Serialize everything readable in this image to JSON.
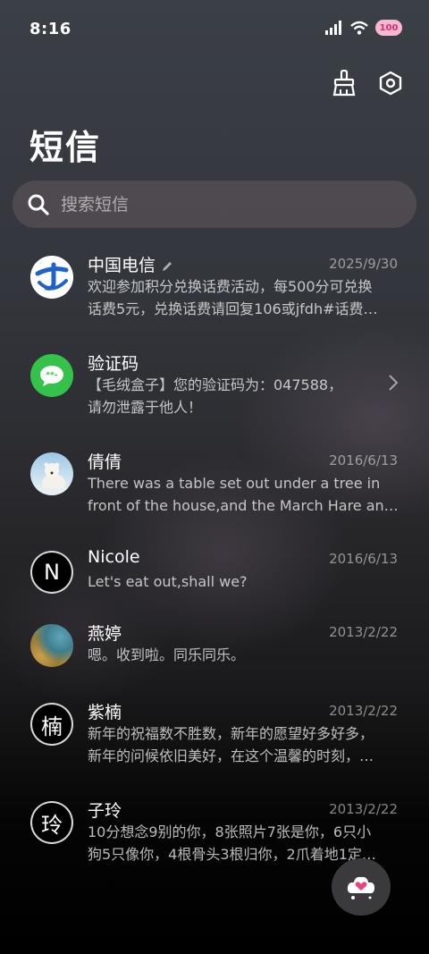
{
  "status": {
    "time": "8:16",
    "battery": "100"
  },
  "header": {
    "title": "短信"
  },
  "search": {
    "placeholder": "搜索短信"
  },
  "conversations": [
    {
      "name": "中国电信",
      "date": "2025/9/30",
      "lines": [
        "欢迎参加积分兑换话费活动，每500分可兑换",
        "话费5元，兑换话费请回复106或jfdh#话费…"
      ],
      "avatar": "china-telecom-logo"
    },
    {
      "name": "验证码",
      "date": "",
      "lines": [
        "【毛绒盒子】您的验证码为：047588，",
        "请勿泄露于他人！"
      ],
      "avatar": "message-bubble-icon"
    },
    {
      "name": "倩倩",
      "date": "2016/6/13",
      "lines": [
        "There was a table set out under a tree in",
        "front of the house,and the March Hare an…"
      ],
      "avatar": "polar-bear-photo"
    },
    {
      "name": "Nicole",
      "date": "2016/6/13",
      "lines": [
        "Let's eat out,shall we?"
      ],
      "avatar_letter": "N"
    },
    {
      "name": "燕婷",
      "date": "2013/2/22",
      "lines": [
        "嗯。收到啦。同乐同乐。"
      ],
      "avatar": "landscape-photo"
    },
    {
      "name": "紫楠",
      "date": "2013/2/22",
      "lines": [
        "新年的祝福数不胜数，新年的愿望好多好多，",
        "新年的问候依旧美好，在这个温馨的时刻，…"
      ],
      "avatar_letter": "楠"
    },
    {
      "name": "子玲",
      "date": "2013/2/22",
      "lines": [
        "10分想念9别的你，8张照片7张是你，6只小",
        "狗5只像你，4根骨头3根归你，2爪着地1定…"
      ],
      "avatar_letter": "玲"
    }
  ],
  "colors": {
    "telecom_blue": "#1f63c7",
    "verify_green": "#35c24a",
    "fab_bg": "#3a3a3c"
  }
}
